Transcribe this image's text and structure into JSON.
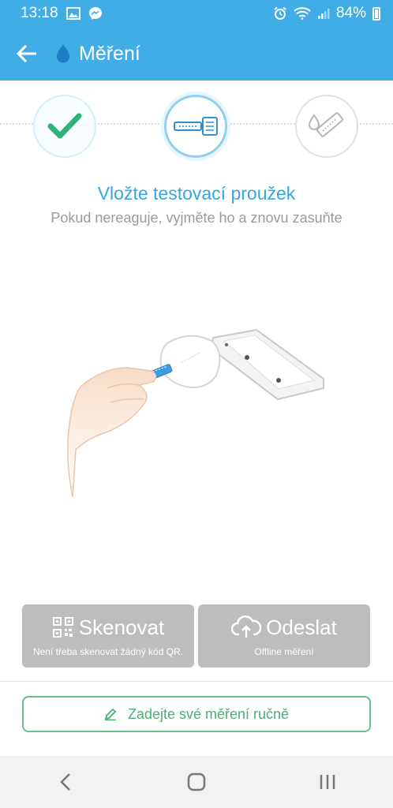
{
  "status_bar": {
    "time": "13:18",
    "battery": "84%"
  },
  "app_bar": {
    "title": "Měření"
  },
  "instruction": {
    "title": "Vložte testovací proužek",
    "subtitle": "Pokud nereaguje, vyjměte ho a znovu zasuňte"
  },
  "actions": {
    "scan": {
      "label": "Skenovat",
      "sub": "Není třeba skenovat žádný kód QR."
    },
    "send": {
      "label": "Odeslat",
      "sub": "Offline měření"
    }
  },
  "manual": {
    "label": "Zadejte své měření ručně"
  },
  "colors": {
    "primary": "#41ade6",
    "accent_green": "#4cae74",
    "disabled_gray": "#bdbdbd"
  }
}
